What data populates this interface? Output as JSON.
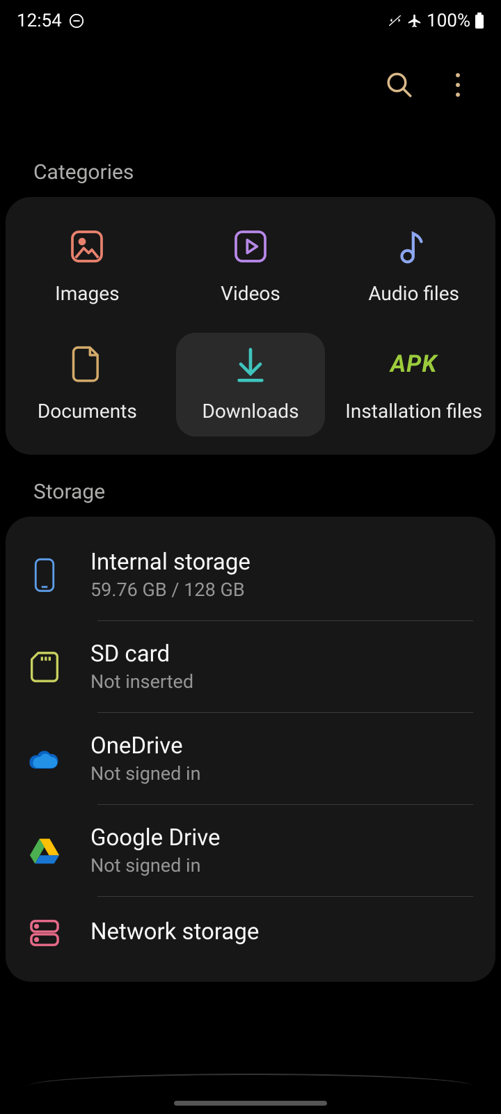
{
  "status": {
    "time": "12:54",
    "battery": "100%"
  },
  "sections": {
    "categories_label": "Categories",
    "storage_label": "Storage"
  },
  "categories": [
    {
      "label": "Images"
    },
    {
      "label": "Videos"
    },
    {
      "label": "Audio files"
    },
    {
      "label": "Documents"
    },
    {
      "label": "Downloads"
    },
    {
      "label": "Installation files",
      "apk_text": "APK"
    }
  ],
  "storage": [
    {
      "title": "Internal storage",
      "sub": "59.76 GB / 128 GB"
    },
    {
      "title": "SD card",
      "sub": "Not inserted"
    },
    {
      "title": "OneDrive",
      "sub": "Not signed in"
    },
    {
      "title": "Google Drive",
      "sub": "Not signed in"
    },
    {
      "title": "Network storage",
      "sub": ""
    }
  ]
}
